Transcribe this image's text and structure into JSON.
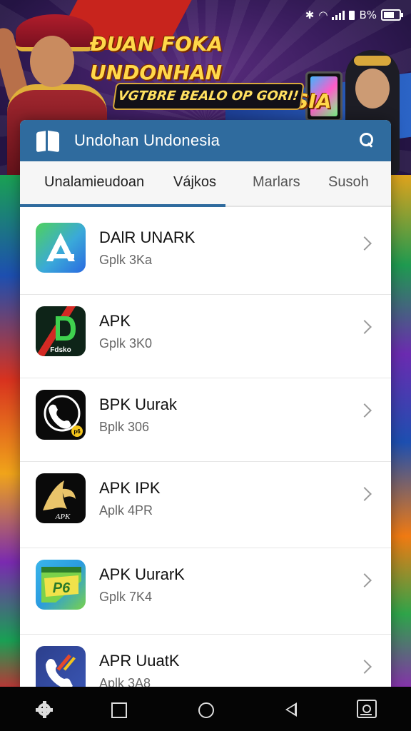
{
  "status_bar": {
    "battery_text": "B%"
  },
  "banner": {
    "title_line1": "ĐUAN FOKA UNDONHAN",
    "title_line2": "BA MAIN INDONSIA",
    "subtitle": "VGTBRE BEALO OP GORI!"
  },
  "header": {
    "title": "Undohan Undonesia",
    "search_icon": "search-icon",
    "logo_icon": "book-icon"
  },
  "tabs": [
    {
      "label": "Unalamieudoan"
    },
    {
      "label": "Vájkos"
    },
    {
      "label": "Marlars"
    },
    {
      "label": "Susoh"
    }
  ],
  "apps": [
    {
      "title": "DAlR UNARK",
      "subtitle": "Gplk 3Ka",
      "icon": "triangle-a-icon"
    },
    {
      "title": "APK",
      "subtitle": "Gplk 3K0",
      "icon": "d-logo-icon",
      "icon_label": "Fdsko"
    },
    {
      "title": "BPK Uurak",
      "subtitle": "Bplk 306",
      "icon": "phone-icon",
      "badge": "p6"
    },
    {
      "title": "APK IPK",
      "subtitle": "Aplk 4PR",
      "icon": "a-signature-icon",
      "icon_label": "APK"
    },
    {
      "title": "APK UurarK",
      "subtitle": "Gplk 7K4",
      "icon": "p6-logo-icon",
      "icon_label": "P6"
    },
    {
      "title": "APR UuatK",
      "subtitle": "Aplk 3A8",
      "icon": "phone-tools-icon"
    }
  ],
  "colors": {
    "header_bg": "#2f6b9e",
    "tab_indicator": "#2f6b9e",
    "banner_text": "#ffd84a"
  }
}
